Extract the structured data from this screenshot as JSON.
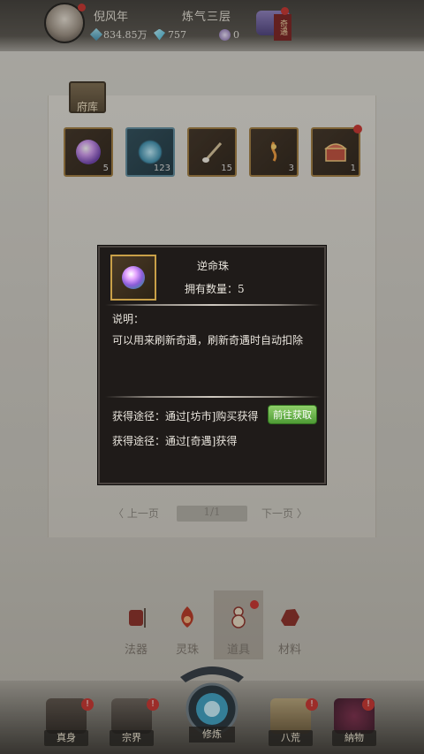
{
  "header": {
    "player_name": "倪风年",
    "realm": "炼气三层",
    "resources": [
      {
        "icon": "spirit-stone-icon",
        "value": "834.85万"
      },
      {
        "icon": "diamond-icon",
        "value": "757"
      },
      {
        "icon": "orb-icon",
        "value": "0"
      }
    ],
    "event_label": "奇遇"
  },
  "inventory": {
    "title": "府库",
    "slots": [
      {
        "icon": "purple-orb-icon",
        "count": "5"
      },
      {
        "icon": "blue-spirit-icon",
        "count": "123"
      },
      {
        "icon": "brush-icon",
        "count": "15"
      },
      {
        "icon": "incense-icon",
        "count": "3"
      },
      {
        "icon": "treasure-chest-icon",
        "count": "1"
      }
    ],
    "pager": {
      "prev": "〈 上一页",
      "page": "1/1",
      "next": "下一页 〉"
    }
  },
  "popup": {
    "item_name": "逆命珠",
    "owned": "拥有数量：5",
    "desc_label": "说明：",
    "desc_text": "可以用来刷新奇遇，刷新奇遇时自动扣除",
    "source1": "获得途径：通过[坊市]购买获得",
    "go_button": "前往获取",
    "source2": "获得途径：通过[奇遇]获得"
  },
  "categories": [
    {
      "label": "法器",
      "icon": "armor-icon"
    },
    {
      "label": "灵珠",
      "icon": "flame-icon"
    },
    {
      "label": "道具",
      "icon": "gourd-icon"
    },
    {
      "label": "材料",
      "icon": "ore-icon"
    }
  ],
  "bottom_nav": [
    {
      "label": "真身",
      "icon": "warrior-icon",
      "badge": "!"
    },
    {
      "label": "宗界",
      "icon": "temple-icon",
      "badge": "!"
    },
    {
      "label": "修炼",
      "icon": "cultivation-emblem-icon"
    },
    {
      "label": "八荒",
      "icon": "map-icon",
      "badge": "!"
    },
    {
      "label": "納物",
      "icon": "bag-icon",
      "badge": "!"
    }
  ],
  "colors": {
    "accent_gold": "#c9a048",
    "badge_red": "#c9302c",
    "button_green": "#6fb34f"
  }
}
